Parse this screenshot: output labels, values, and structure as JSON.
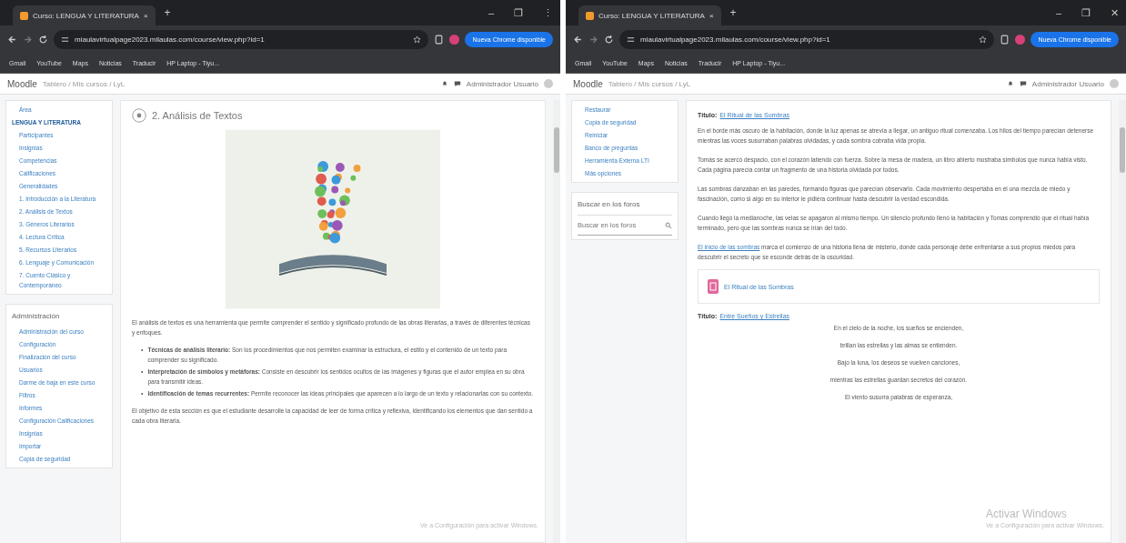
{
  "windows": [
    {
      "tab": {
        "title": "Curso: LENGUA Y LITERATURA",
        "close": "×"
      },
      "new_tab": "+",
      "window_controls": [
        "–",
        "❐",
        "⋮"
      ],
      "url": "miaulavirtualpage2023.milaulas.com/course/view.php?id=1",
      "update_button": "Nueva Chrome disponible",
      "bookmarks": [
        "Gmail",
        "YouTube",
        "Maps",
        "Noticias",
        "Traducir",
        "HP Laptop - Tiyu..."
      ],
      "site": {
        "logo": "Moodle",
        "breadcrumb": "Tablero / Mis cursos / LyL",
        "user": "Administrador Usuario"
      },
      "sidebar": [
        {
          "items": [
            {
              "label": "Área",
              "selected": false
            },
            {
              "label": "LENGUA Y LITERATURA",
              "selected": true
            },
            {
              "label": "Participantes",
              "selected": false
            },
            {
              "label": "Insignias",
              "selected": false
            },
            {
              "label": "Competencias",
              "selected": false
            },
            {
              "label": "Calificaciones",
              "selected": false
            },
            {
              "label": "Generalidades",
              "selected": false
            },
            {
              "label": "1. Introducción a la Literatura",
              "selected": false
            },
            {
              "label": "2. Análisis de Textos",
              "selected": false
            },
            {
              "label": "3. Géneros Literarios",
              "selected": false
            },
            {
              "label": "4. Lectura Crítica",
              "selected": false
            },
            {
              "label": "5. Recursos Literarios",
              "selected": false
            },
            {
              "label": "6. Lenguaje y Comunicación",
              "selected": false
            },
            {
              "label": "7. Cuento Clásico y Contemporáneo",
              "selected": false
            }
          ]
        },
        {
          "title": "Administración",
          "items": [
            {
              "label": "Administración del curso",
              "selected": false
            },
            {
              "label": "Configuración",
              "selected": false
            },
            {
              "label": "Finalización del curso",
              "selected": false
            },
            {
              "label": "Usuarios",
              "selected": false
            },
            {
              "label": "Darme de baja en este curso",
              "selected": false
            },
            {
              "label": "Filtros",
              "selected": false
            },
            {
              "label": "Informes",
              "selected": false
            },
            {
              "label": "Configuración Calificaciones",
              "selected": false
            },
            {
              "label": "Insignias",
              "selected": false
            },
            {
              "label": "Importar",
              "selected": false
            },
            {
              "label": "Copia de seguridad",
              "selected": false
            }
          ]
        }
      ],
      "content": [
        {
          "kind": "heading",
          "text": "2. Análisis de Textos"
        },
        {
          "kind": "image"
        },
        {
          "kind": "paragraph",
          "text": "El análisis de textos es una herramienta que permite comprender el sentido y significado profundo de las obras literarias, a través de diferentes técnicas y enfoques."
        },
        {
          "kind": "list",
          "bullet": "•",
          "items": [
            "**Técnicas de análisis literario:** Son los procedimientos que nos permiten examinar la estructura, el estilo y el contenido de un texto para comprender su significado.",
            "**Interpretación de símbolos y metáforas:** Consiste en descubrir los sentidos ocultos de las imágenes y figuras que el autor emplea en su obra para transmitir ideas.",
            "**Identificación de temas recurrentes:** Permite reconocer las ideas principales que aparecen a lo largo de un texto y relacionarlas con su contexto."
          ]
        },
        {
          "kind": "paragraph",
          "text": "El objetivo de esta sección es que el estudiante desarrolle la capacidad de leer de forma crítica y reflexiva, identificando los elementos que dan sentido a cada obra literaria."
        }
      ],
      "watermark": [
        "Ve a Configuración para activar Windows."
      ]
    },
    {
      "tab": {
        "title": "Curso: LENGUA Y LITERATURA",
        "close": "×"
      },
      "new_tab": "+",
      "window_controls": [
        "–",
        "❐",
        "✕"
      ],
      "url": "miaulavirtualpage2023.milaulas.com/course/view.php?id=1",
      "update_button": "Nueva Chrome disponible",
      "bookmarks": [
        "Gmail",
        "YouTube",
        "Maps",
        "Noticias",
        "Traducir",
        "HP Laptop - Tiyu..."
      ],
      "site": {
        "logo": "Moodle",
        "breadcrumb": "Tablero / Mis cursos / LyL",
        "user": "Administrador Usuario"
      },
      "sidebar": [
        {
          "items": [
            {
              "label": "Restaurar",
              "selected": false
            },
            {
              "label": "Copia de seguridad",
              "selected": false
            },
            {
              "label": "Reiniciar",
              "selected": false
            },
            {
              "label": "Banco de preguntas",
              "selected": false
            },
            {
              "label": "Herramienta Externa LTI",
              "selected": false
            },
            {
              "label": "Más opciones",
              "selected": false
            }
          ]
        }
      ],
      "search": {
        "title": "Buscar en los foros",
        "placeholder": "Buscar en los foros"
      },
      "content": [
        {
          "kind": "title_link",
          "label": "Título:",
          "link": "El Ritual de las Sombras"
        },
        {
          "kind": "paragraph",
          "text": "En el borde más oscuro de la habitación, donde la luz apenas se atrevía a llegar, un antiguo ritual comenzaba. Los hilos del tiempo parecían detenerse mientras las voces susurraban palabras olvidadas, y cada sombra cobraba vida propia."
        },
        {
          "kind": "paragraph",
          "text": "Tomás se acercó despacio, con el corazón latiendo con fuerza. Sobre la mesa de madera, un libro abierto mostraba símbolos que nunca había visto. Cada página parecía contar un fragmento de una historia olvidada por todos."
        },
        {
          "kind": "paragraph",
          "text": "Las sombras danzaban en las paredes, formando figuras que parecían observarlo. Cada movimiento despertaba en él una mezcla de miedo y fascinación, como si algo en su interior le pidiera continuar hasta descubrir la verdad escondida."
        },
        {
          "kind": "paragraph",
          "text": "Cuando llegó la medianoche, las velas se apagaron al mismo tiempo. Un silencio profundo llenó la habitación y Tomás comprendió que el ritual había terminado, pero que las sombras nunca se irían del todo."
        },
        {
          "kind": "paragraph",
          "link": "El inicio de las sombras",
          "text": "marca el comienzo de una historia llena de misterio, donde cada personaje debe enfrentarse a sus propios miedos para descubrir el secreto que se esconde detrás de la oscuridad."
        },
        {
          "kind": "activity",
          "link": "El Ritual de las Sombras"
        },
        {
          "kind": "title_link",
          "label": "Título:",
          "link": "Entre Sueños y Estrellas"
        },
        {
          "kind": "poem",
          "lines": [
            "En el cielo de la noche, los sueños se encienden,",
            "brillan las estrellas y las almas se entienden.",
            "Bajo la luna, los deseos se vuelven canciones,",
            "mientras las estrellas guardan secretos del corazón.",
            "El viento susurra palabras de esperanza,"
          ]
        }
      ],
      "watermark": [
        "Activar Windows",
        "Ve a Configuración para activar Windows."
      ]
    }
  ]
}
